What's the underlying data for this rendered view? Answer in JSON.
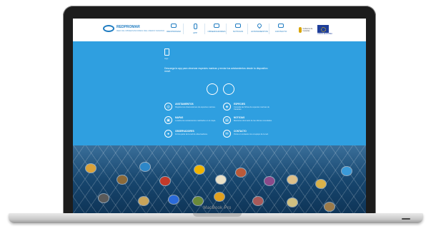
{
  "device": {
    "model_label": "MacBook Pro"
  },
  "site": {
    "logo_text": "REDPROMAR",
    "logo_sub": "RED DE OBSERVADORES DEL MEDIO MARINO",
    "nav": [
      {
        "label": "REDPROMAR",
        "icon": "eye-icon"
      },
      {
        "label": "APP",
        "icon": "phone-icon"
      },
      {
        "label": "OBSERVADORES",
        "icon": "binoculars-icon"
      },
      {
        "label": "NOTICIAS",
        "icon": "news-icon"
      },
      {
        "label": "AVISTAMIENTOS",
        "icon": "pin-icon"
      },
      {
        "label": "CONTACTO",
        "icon": "mail-icon"
      }
    ],
    "partner_1": "Gobierno de Canarias",
    "partner_2": "UNIÓN EUROPEA"
  },
  "hero": {
    "title": "App",
    "text": "Descarga la app para observar especies marinas y enviar tus avistamientos desde tu dispositivo móvil."
  },
  "store_buttons": [
    {
      "icon": "apple-icon"
    },
    {
      "icon": "android-icon"
    }
  ],
  "features": [
    {
      "title": "AVISTAMIENTOS",
      "desc": "Registra tus observaciones de especies marinas.",
      "icon": "eye-icon"
    },
    {
      "title": "ESPECIES",
      "desc": "Consulta las fichas de especies marinas de Canarias.",
      "icon": "fish-icon"
    },
    {
      "title": "MAPAS",
      "desc": "Localiza los avistamientos realizados en el mapa.",
      "icon": "map-icon"
    },
    {
      "title": "NOTICIAS",
      "desc": "Mantente informado de las últimas novedades.",
      "icon": "news-icon"
    },
    {
      "title": "OBSERVADORES",
      "desc": "Forma parte de la red de observadores.",
      "icon": "user-icon"
    },
    {
      "title": "CONTACTO",
      "desc": "Ponte en contacto con el equipo de la red.",
      "icon": "mail-icon"
    }
  ],
  "colors": {
    "accent": "#2f9fe0",
    "brand": "#1f7cc1",
    "ocean_dark": "#0e3457"
  }
}
